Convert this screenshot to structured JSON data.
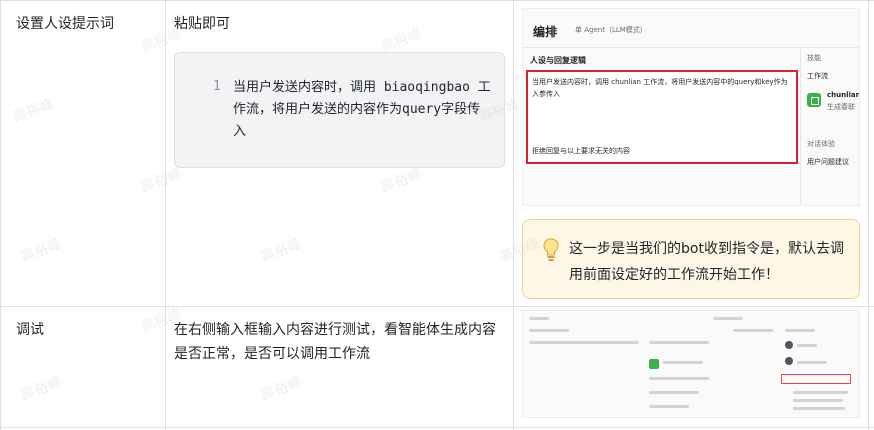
{
  "rows": [
    {
      "step": "设置人设提示词",
      "action": "粘贴即可",
      "code": {
        "line_number": "1",
        "text": "当用户发送内容时，调用 biaoqingbao 工作流，将用户发送的内容作为query字段传入"
      }
    },
    {
      "step": "调试",
      "action": "在右侧输入框输入内容进行测试，看智能体生成内容是否正常，是否可以调用工作流"
    }
  ],
  "screenshot1": {
    "title": "编排",
    "mode": "单 Agent（LLM模式）",
    "section_title": "人设与回复逻辑",
    "prompt_text": "当用户发送内容时，调用 chunlian 工作流，将用户发送内容中的query和key作为入参传入",
    "prompt_text2": "拒绝回复与以上要求无关的内容",
    "right_panel": {
      "skills": "技能",
      "workflow": "工作流",
      "plugin_name": "chunlian",
      "plugin_desc": "生成春联",
      "dialog_exp": "对话体验",
      "suggest": "用户问题建议"
    }
  },
  "callout": {
    "icon": "lightbulb-icon",
    "text": "这一步是当我们的bot收到指令是，默认去调用前面设定好的工作流开始工作！"
  },
  "watermark": "高裕峰",
  "colors": {
    "border": "#dee0e3",
    "highlight_red": "#d9232c",
    "callout_bg": "#fef7e6",
    "callout_border": "#f7cf8d"
  }
}
